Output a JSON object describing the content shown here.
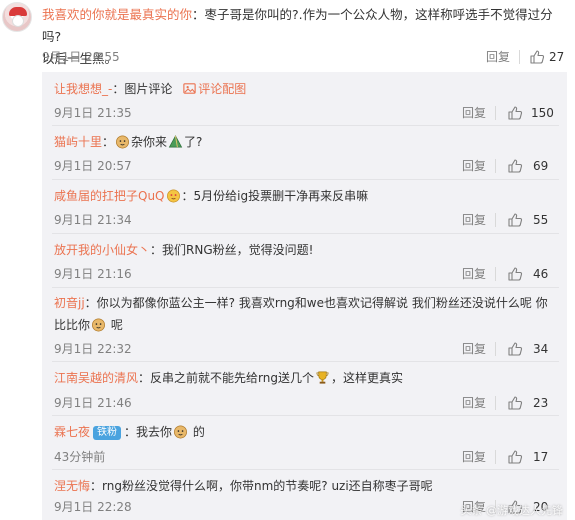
{
  "main_comment": {
    "username": "我喜欢的你就是最真实的你",
    "text_line1": "：枣子哥是你叫的?.作为一个公众人物，这样称呼选手不觉得过分吗?",
    "text_line2": "以后一生黑。",
    "time": "9月1日 20:55",
    "reply_label": "回复",
    "likes": "27"
  },
  "sub_comments": [
    {
      "username": "让我想想_-",
      "text": "：图片评论",
      "link_text": "评论配图",
      "time": "9月1日 21:35",
      "reply_label": "回复",
      "likes": "150"
    },
    {
      "username": "猫屿十里",
      "text_before": "：",
      "text_mid": "杂你来",
      "text_after": "了?",
      "time": "9月1日 20:57",
      "reply_label": "回复",
      "likes": "69"
    },
    {
      "username": "咸鱼届的扛把子QuQ",
      "text": "：5月份给ig投票删干净再来反串嘛",
      "time": "9月1日 21:34",
      "reply_label": "回复",
      "likes": "55"
    },
    {
      "username": "放开我的小仙女丶",
      "text": "：我们RNG粉丝，觉得没问题!",
      "time": "9月1日 21:16",
      "reply_label": "回复",
      "likes": "46"
    },
    {
      "username": "初音jj",
      "text_line1": "：你以为都像你蓝公主一样?  我喜欢rng和we也喜欢记得解说 我们粉丝还没说什么呢 你",
      "text_line2_before": "比比你",
      "text_line2_after": "呢",
      "time": "9月1日 22:32",
      "reply_label": "回复",
      "likes": "34"
    },
    {
      "username": "江南吴越的清风",
      "text_before": "：反串之前就不能先给rng送几个",
      "text_after": "，这样更真实",
      "time": "9月1日 21:46",
      "reply_label": "回复",
      "likes": "23"
    },
    {
      "username": "霖七夜",
      "badge": "铁粉",
      "text_before": "：我去你",
      "text_after": "的",
      "time": "43分钟前",
      "reply_label": "回复",
      "likes": "17"
    },
    {
      "username": "涅无悔",
      "text": "：rng粉丝没觉得什么啊，你带nm的节奏呢? uzi还自称枣子哥呢",
      "time": "9月1日 22:28",
      "reply_label": "回复",
      "likes": "20"
    }
  ],
  "watermark": "头条 @游戏达人先锋",
  "colors": {
    "username": "#eb7350",
    "panel_bg": "#f2f2f5",
    "meta": "#808080",
    "badge": "#4aa3df"
  },
  "icons": {
    "like": "thumbs-up-icon",
    "image_comment": "picture-icon"
  }
}
